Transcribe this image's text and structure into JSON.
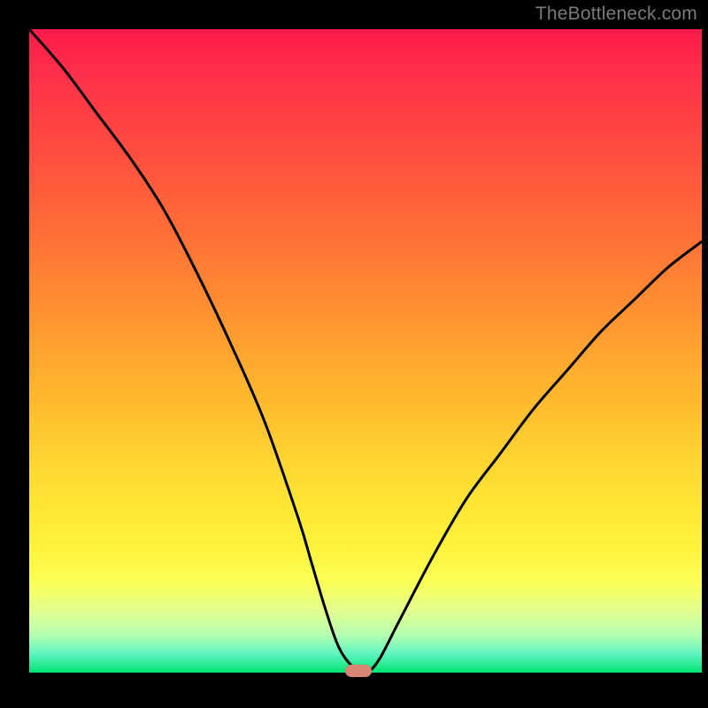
{
  "watermark": "TheBottleneck.com",
  "colors": {
    "curve": "#000000",
    "marker": "#d88574",
    "frame": "#000000"
  },
  "chart_data": {
    "type": "line",
    "title": "",
    "xlabel": "",
    "ylabel": "",
    "xlim": [
      0,
      100
    ],
    "ylim": [
      0,
      100
    ],
    "grid": false,
    "legend": false,
    "annotations": [
      {
        "text": "TheBottleneck.com",
        "position": "top-right"
      }
    ],
    "series": [
      {
        "name": "bottleneck-curve",
        "x": [
          0,
          5,
          10,
          15,
          20,
          25,
          30,
          35,
          40,
          42,
          44,
          46,
          48,
          50,
          52,
          55,
          60,
          65,
          70,
          75,
          80,
          85,
          90,
          95,
          100
        ],
        "values": [
          100,
          94,
          87,
          80,
          72,
          62,
          51,
          39,
          24,
          17,
          10,
          4,
          1,
          0,
          2,
          8,
          18,
          27,
          34,
          41,
          47,
          53,
          58,
          63,
          67
        ]
      }
    ],
    "marker": {
      "x": 49,
      "y": 0
    },
    "background_gradient": {
      "top": "#ff1a4a",
      "mid": "#ffe233",
      "bottom": "#00e472"
    }
  }
}
